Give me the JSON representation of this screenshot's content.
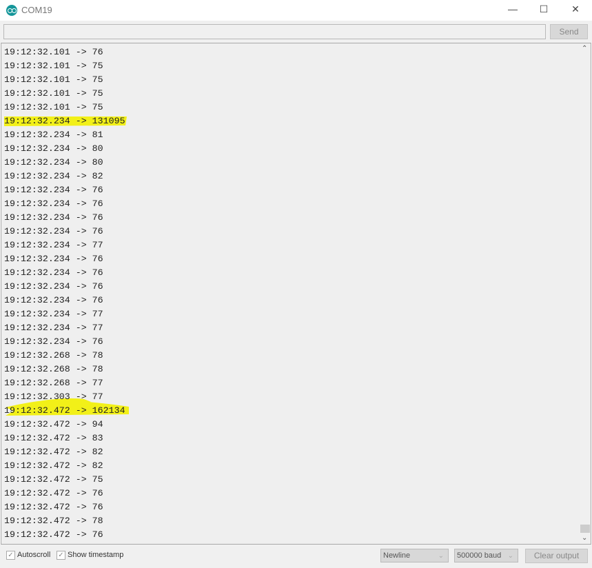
{
  "window": {
    "title": "COM19",
    "minimize_icon": "minimize-icon",
    "maximize_icon": "maximize-icon",
    "close_icon": "close-icon"
  },
  "input": {
    "value": "",
    "send_label": "Send"
  },
  "output": {
    "lines": [
      "19:12:32.101 -> 76",
      "19:12:32.101 -> 75",
      "19:12:32.101 -> 75",
      "19:12:32.101 -> 75",
      "19:12:32.101 -> 75",
      "19:12:32.234 -> 131095",
      "19:12:32.234 -> 81",
      "19:12:32.234 -> 80",
      "19:12:32.234 -> 80",
      "19:12:32.234 -> 82",
      "19:12:32.234 -> 76",
      "19:12:32.234 -> 76",
      "19:12:32.234 -> 76",
      "19:12:32.234 -> 76",
      "19:12:32.234 -> 77",
      "19:12:32.234 -> 76",
      "19:12:32.234 -> 76",
      "19:12:32.234 -> 76",
      "19:12:32.234 -> 76",
      "19:12:32.234 -> 77",
      "19:12:32.234 -> 77",
      "19:12:32.234 -> 76",
      "19:12:32.268 -> 78",
      "19:12:32.268 -> 78",
      "19:12:32.268 -> 77",
      "19:12:32.303 -> 77",
      "19:12:32.472 -> 162134",
      "19:12:32.472 -> 94",
      "19:12:32.472 -> 83",
      "19:12:32.472 -> 82",
      "19:12:32.472 -> 82",
      "19:12:32.472 -> 75",
      "19:12:32.472 -> 76",
      "19:12:32.472 -> 76",
      "19:12:32.472 -> 78",
      "19:12:32.472 -> 76"
    ],
    "highlight_color": "#f5f000"
  },
  "footer": {
    "autoscroll_label": "Autoscroll",
    "autoscroll_checked": true,
    "timestamp_label": "Show timestamp",
    "timestamp_checked": true,
    "line_ending": "Newline",
    "baud": "500000 baud",
    "clear_label": "Clear output"
  }
}
